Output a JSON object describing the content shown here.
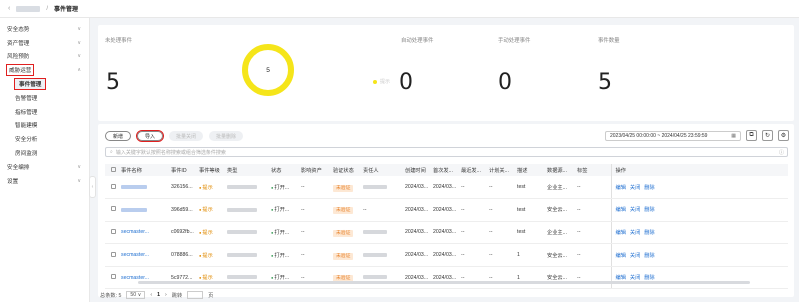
{
  "breadcrumb": {
    "back": "‹",
    "sep": "/",
    "current": "事件管理"
  },
  "sidebar": {
    "items": [
      {
        "label": "安全态势",
        "chev": "∨"
      },
      {
        "label": "资产管理",
        "chev": "∨"
      },
      {
        "label": "风险预防",
        "chev": "∨"
      },
      {
        "label": "威胁运营",
        "chev": "∧"
      },
      {
        "label": "事件管理"
      },
      {
        "label": "告警管理"
      },
      {
        "label": "指标管理"
      },
      {
        "label": "智能建模"
      },
      {
        "label": "安全分析"
      },
      {
        "label": "房间监测"
      },
      {
        "label": "安全编排",
        "chev": "∨"
      },
      {
        "label": "设置",
        "chev": "∨"
      }
    ]
  },
  "stats": {
    "unprocessed_label": "未处理事件",
    "unprocessed_value": "5",
    "donut_value": "5",
    "auto_label": "自动处理事件",
    "auto_value": "0",
    "manual_label": "手动处理事件",
    "manual_value": "0",
    "total_label": "事件数量",
    "total_value": "5",
    "legend_label": "提示"
  },
  "toolbar": {
    "new_label": "新增",
    "import_label": "导入",
    "batch_close_label": "批量关闭",
    "batch_delete_label": "批量删除",
    "date_range": "2023/04/25 00:00:00 ~ 2024/04/25 23:59:59",
    "calendar_icon": "▦"
  },
  "search": {
    "placeholder": "输入关键字默认按照名称搜索或组合筛选条件搜索"
  },
  "table": {
    "columns": [
      "事件名称",
      "事件ID",
      "事件等级",
      "类型",
      "状态",
      "影响资产",
      "验证状态",
      "责任人",
      "创建时间",
      "首次发...",
      "最近发...",
      "计划关...",
      "描述",
      "数据源...",
      "标签",
      "操作"
    ],
    "rows": [
      {
        "name": "",
        "id": "326156...",
        "level": "提示",
        "status": "打开...",
        "asset": "--",
        "verify": "未验证",
        "owner": "",
        "created": "2024/03...",
        "first": "2024/03...",
        "recent": "--",
        "plan": "--",
        "desc": "test",
        "source": "企业主...",
        "tag": "--"
      },
      {
        "name": "",
        "id": "396d59...",
        "level": "提示",
        "status": "打开...",
        "asset": "--",
        "verify": "未验证",
        "owner": "--",
        "created": "2024/03...",
        "first": "2024/03...",
        "recent": "--",
        "plan": "--",
        "desc": "test",
        "source": "安全云...",
        "tag": "--"
      },
      {
        "name": "secmaster...",
        "id": "c0692fb...",
        "level": "提示",
        "status": "打开...",
        "asset": "--",
        "verify": "未验证",
        "owner": "",
        "created": "2024/03...",
        "first": "2024/03...",
        "recent": "--",
        "plan": "--",
        "desc": "test",
        "source": "企业主...",
        "tag": "--"
      },
      {
        "name": "secmaster...",
        "id": "078886...",
        "level": "提示",
        "status": "打开...",
        "asset": "--",
        "verify": "未验证",
        "owner": "",
        "created": "2024/03...",
        "first": "2024/03...",
        "recent": "--",
        "plan": "--",
        "desc": "1",
        "source": "安全云...",
        "tag": "--"
      },
      {
        "name": "secmaster...",
        "id": "5c9772...",
        "level": "提示",
        "status": "打开...",
        "asset": "--",
        "verify": "未验证",
        "owner": "",
        "created": "2024/03...",
        "first": "2024/03...",
        "recent": "--",
        "plan": "--",
        "desc": "1",
        "source": "安全云...",
        "tag": "--"
      }
    ],
    "ops": {
      "edit": "编辑",
      "close": "关闭",
      "delete": "删除"
    }
  },
  "pagination": {
    "total_label": "总条数: 5",
    "page_size": "50",
    "prev": "‹",
    "current": "1",
    "next": "›",
    "jump_label": "跳转",
    "page_unit": "页"
  }
}
